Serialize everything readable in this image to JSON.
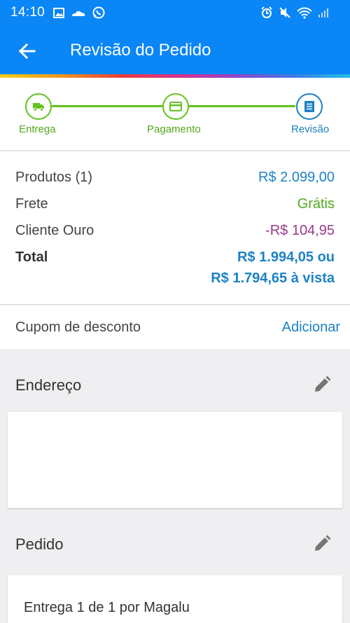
{
  "status_bar": {
    "time": "14:10",
    "left_icons": [
      "image-icon",
      "cloud-icon",
      "whatsapp-icon"
    ],
    "right_icons": [
      "alarm-icon",
      "mute-icon",
      "wifi-icon",
      "signal-icon"
    ]
  },
  "header": {
    "title": "Revisão do Pedido",
    "color": "#0a86f7"
  },
  "stepper": {
    "steps": [
      {
        "label": "Entrega",
        "icon": "truck-icon",
        "state": "done"
      },
      {
        "label": "Pagamento",
        "icon": "card-icon",
        "state": "done"
      },
      {
        "label": "Revisão",
        "icon": "document-icon",
        "state": "active"
      }
    ]
  },
  "summary": {
    "products_label": "Produtos (1)",
    "products_value": "R$ 2.099,00",
    "shipping_label": "Frete",
    "shipping_value": "Grátis",
    "gold_label": "Cliente Ouro",
    "gold_value": "-R$ 104,95",
    "total_label": "Total",
    "total_value_1": "R$ 1.994,05 ou",
    "total_value_2": "R$ 1.794,65 à vista"
  },
  "coupon": {
    "label": "Cupom de desconto",
    "action": "Adicionar"
  },
  "address": {
    "title": "Endereço"
  },
  "order": {
    "title": "Pedido",
    "delivery_text": "Entrega 1 de 1 por Magalu"
  }
}
